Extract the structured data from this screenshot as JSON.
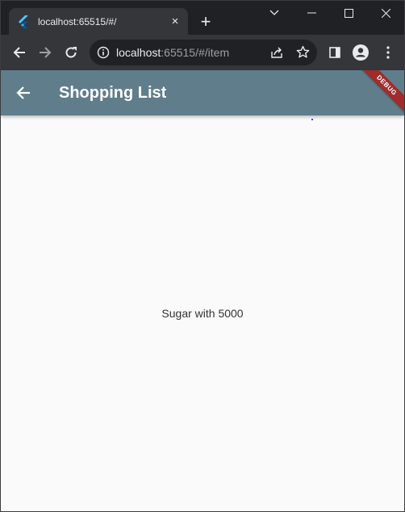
{
  "browser": {
    "tab": {
      "title": "localhost:65515/#/",
      "favicon": "flutter-icon",
      "close": "×"
    },
    "new_tab": "+",
    "window_controls": [
      "chevron-down-icon",
      "minimize-icon",
      "maximize-icon",
      "close-icon"
    ],
    "address": {
      "host": "localhost",
      "path": ":65515/#/item"
    },
    "colors": {
      "frame": "#202124",
      "toolbar": "#35363a",
      "text": "#e8eaed",
      "muted": "#9aa0a6"
    }
  },
  "app": {
    "appbar": {
      "title": "Shopping List",
      "back_icon": "arrow-back-icon",
      "color": "#607d8b"
    },
    "debug_banner": "DEBUG",
    "body_text": "Sugar with 5000",
    "background": "#fafafa"
  }
}
